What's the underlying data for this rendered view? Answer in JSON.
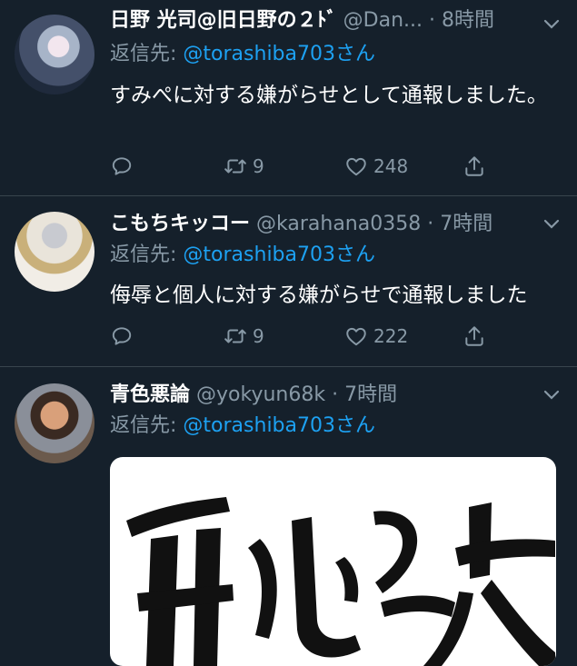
{
  "tweets": [
    {
      "name": "日野 光司@旧日野の２ﾄﾞ",
      "handle": "@Dan...",
      "time": "· 8時間",
      "reply_prefix": "返信先:",
      "reply_to": "@torashiba703さん",
      "text": "すみぺに対する嫌がらせとして通報しました。",
      "retweets": "9",
      "likes": "248"
    },
    {
      "name": "こもちキッコー",
      "handle": "@karahana0358",
      "time": "· 7時間",
      "reply_prefix": "返信先:",
      "reply_to": "@torashiba703さん",
      "text": "侮辱と個人に対する嫌がらせで通報しました",
      "retweets": "9",
      "likes": "222"
    },
    {
      "name": "青色悪論",
      "handle": "@yokyun68k",
      "time": "· 7時間",
      "reply_prefix": "返信先:",
      "reply_to": "@torashiba703さん"
    }
  ],
  "colors": {
    "background": "#15202b",
    "divider": "#38444d",
    "secondary_text": "#8899a6",
    "link": "#1da1f2"
  },
  "icons": [
    "reply-icon",
    "retweet-icon",
    "like-icon",
    "share-icon",
    "chevron-down-icon"
  ]
}
